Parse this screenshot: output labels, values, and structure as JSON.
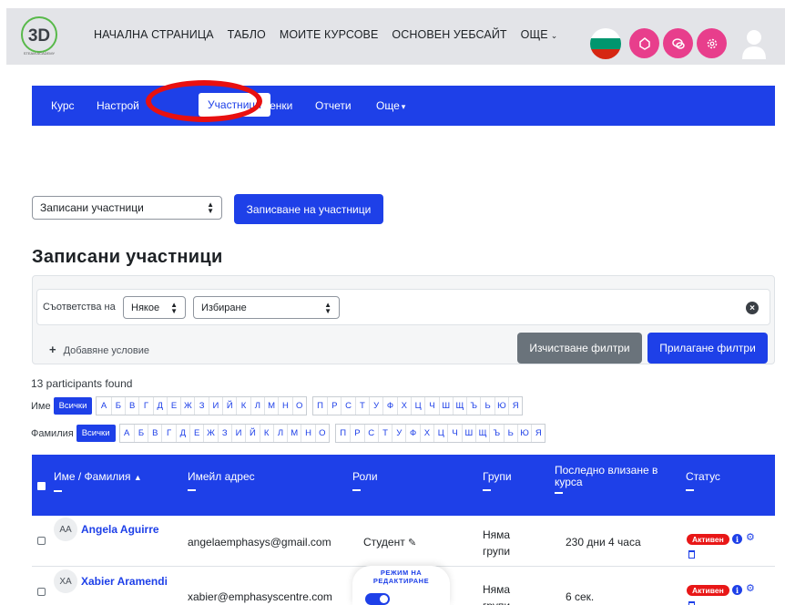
{
  "topnav": {
    "items": [
      "НАЧАЛНА СТРАНИЦА",
      "ТАБЛО",
      "МОИТЕ КУРСОВЕ",
      "ОСНОВЕН УЕБСАЙТ",
      "ОЩЕ"
    ],
    "logo_text": "3D",
    "logo_caption": "STEAM ACADEMY"
  },
  "secnav": {
    "items": [
      "Курс",
      "Настрой",
      "Участници",
      "Оценки",
      "Отчети",
      "Още"
    ],
    "active_label": "Участници"
  },
  "enrol": {
    "select_value": "Записани участници",
    "button_label": "Записване на участници"
  },
  "page_title": "Записани участници",
  "filters": {
    "match_label": "Съответства на",
    "match_value": "Някое",
    "choose_value": "Избиране",
    "add_condition": "Добавяне условие",
    "clear_label": "Изчистване филтри",
    "apply_label": "Прилагане филтри"
  },
  "found_text": "13 participants found",
  "letters": {
    "first_label": "Име",
    "last_label": "Фамилия",
    "all_label": "Всички",
    "group1": [
      "А",
      "Б",
      "В",
      "Г",
      "Д",
      "Е",
      "Ж",
      "З",
      "И",
      "Й",
      "К",
      "Л",
      "М",
      "Н",
      "О"
    ],
    "group2": [
      "П",
      "Р",
      "С",
      "Т",
      "У",
      "Ф",
      "Х",
      "Ц",
      "Ч",
      "Ш",
      "Щ",
      "Ъ",
      "Ь",
      "Ю",
      "Я"
    ]
  },
  "table": {
    "headers": {
      "name": "Име / Фамилия",
      "email": "Имейл адрес",
      "roles": "Роли",
      "groups": "Групи",
      "lastaccess": "Последно влизане в курса",
      "status": "Статус"
    },
    "rows": [
      {
        "initials": "AA",
        "name": "Angela Aguirre",
        "email": "angelaemphasys@gmail.com",
        "role": "Студент",
        "groups": "Няма групи",
        "lastaccess": "230 дни 4 часа",
        "status": "Активен"
      },
      {
        "initials": "XA",
        "name": "Xabier Aramendi",
        "email": "xabier@emphasyscentre.com",
        "role": "",
        "groups": "Няма групи",
        "lastaccess": "6 сек.",
        "status": "Активен"
      }
    ]
  },
  "editmode": {
    "label": "РЕЖИМ НА РЕДАКТИРАНЕ"
  },
  "colors": {
    "primary": "#1e40e8",
    "accent_pink": "#e83e8c",
    "badge_red": "#e81717",
    "highlight_ring": "#e81010"
  }
}
